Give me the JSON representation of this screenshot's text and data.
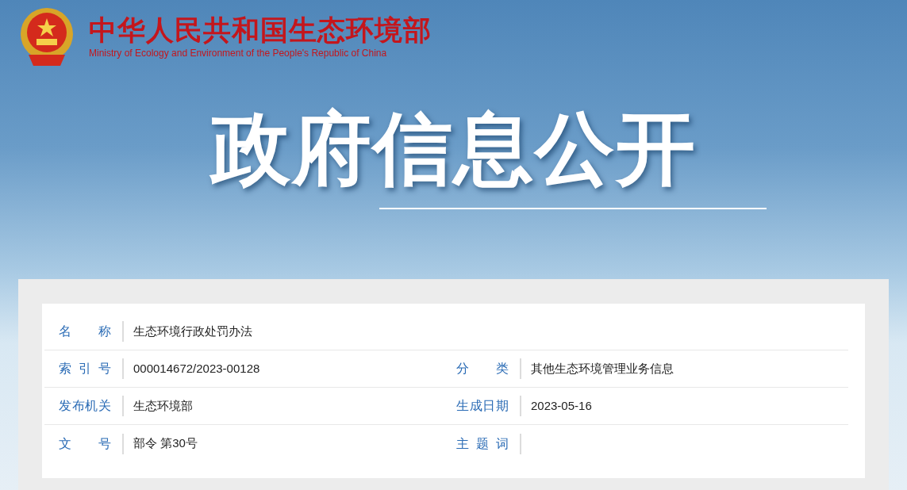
{
  "site": {
    "title": "中华人民共和国生态环境部",
    "subtitle": "Ministry of Ecology and Environment of the People's Republic of China"
  },
  "banner_title": "政府信息公开",
  "info_rows": [
    [
      {
        "label": "名称",
        "value": "生态环境行政处罚办法"
      }
    ],
    [
      {
        "label": "索引号",
        "value": "000014672/2023-00128"
      },
      {
        "label": "分类",
        "value": "其他生态环境管理业务信息"
      }
    ],
    [
      {
        "label": "发布机关",
        "value": "生态环境部"
      },
      {
        "label": "生成日期",
        "value": "2023-05-16"
      }
    ],
    [
      {
        "label": "文号",
        "value": "部令 第30号"
      },
      {
        "label": "主题词"
      }
    ]
  ]
}
